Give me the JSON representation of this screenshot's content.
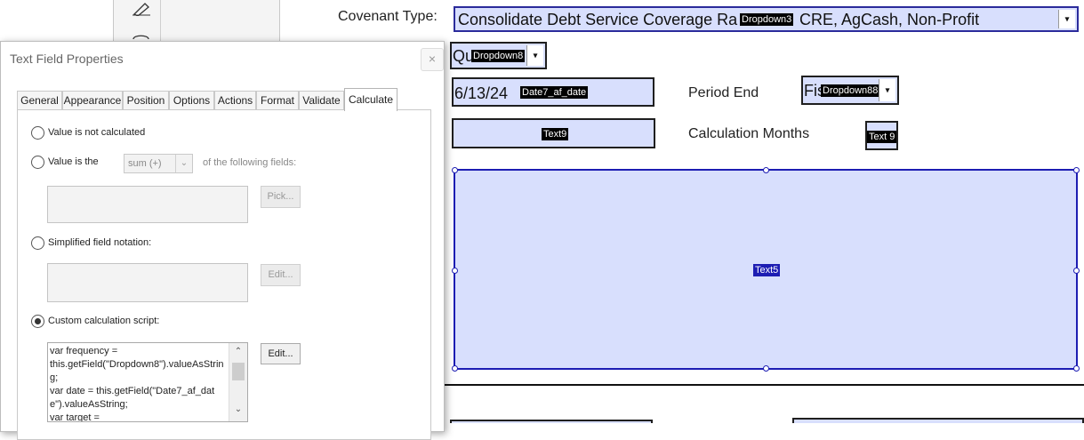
{
  "form": {
    "covenant_type_label": "Covenant Type:",
    "covenant_type_value": "Consolidate Debt Service Coverage Ra",
    "covenant_type_value_tail": "CRE, AgCash, Non-Profit",
    "dropdown3_tag": "Dropdown3",
    "frequency_value": "Qu",
    "dropdown8_tag": "Dropdown8",
    "date_value": "6/13/24",
    "date_tag": "Date7_af_date",
    "period_end_label": "Period End",
    "period_end_value": "Fis",
    "dropdown88_tag": "Dropdown88",
    "text9_tag": "Text9",
    "calc_months_label": "Calculation Months",
    "text9b_tag": "Text 9",
    "text5_tag": "Text5"
  },
  "dialog": {
    "title": "Text Field Properties",
    "close_symbol": "×",
    "tabs": [
      "General",
      "Appearance",
      "Position",
      "Options",
      "Actions",
      "Format",
      "Validate",
      "Calculate"
    ],
    "active_tab": "Calculate",
    "opt_not_calculated": "Value is not calculated",
    "opt_value_is": "Value is the",
    "value_function": "sum (+)",
    "of_following": "of the following fields:",
    "pick_button": "Pick...",
    "opt_simplified": "Simplified field notation:",
    "edit_button_1": "Edit...",
    "opt_custom": "Custom calculation script:",
    "edit_button_2": "Edit...",
    "script_text": "var frequency =\nthis.getField(\"Dropdown8\").valueAsString;\nvar date = this.getField(\"Date7_af_date\").valueAsString;\nvar target ="
  },
  "icons": [
    "pen-icon",
    "lasso-icon",
    "chevron-down-icon",
    "chevron-up-icon",
    "close-icon"
  ],
  "colors": {
    "field_bg": "#d8dffd",
    "selection_border": "#1d1db3",
    "tag_bg": "#000000"
  }
}
